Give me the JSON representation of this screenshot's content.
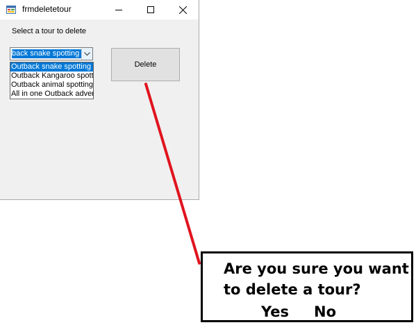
{
  "window": {
    "title": "frmdeletetour",
    "icon": "app-form-icon",
    "controls": [
      "minimize-icon",
      "maximize-icon",
      "close-icon"
    ]
  },
  "form": {
    "prompt": "Select a tour to delete",
    "combo": {
      "value": "Outback snake spotting",
      "shown_text": "back snake spotting"
    },
    "dropdown_items": [
      "Outback snake spotting",
      "Outback Kangaroo spotting",
      "Outback animal spotting",
      "All in one Outback adventure"
    ],
    "selected_index": 0,
    "delete_label": "Delete"
  },
  "annotation": {
    "message": "Are you sure you want to delete a tour?",
    "yes_label": "Yes",
    "no_label": "No",
    "arrow_color": "#e0141e"
  },
  "colors": {
    "selection": "#0078d7",
    "window_bg": "#f0f0f0",
    "button_bg": "#e1e1e1"
  }
}
